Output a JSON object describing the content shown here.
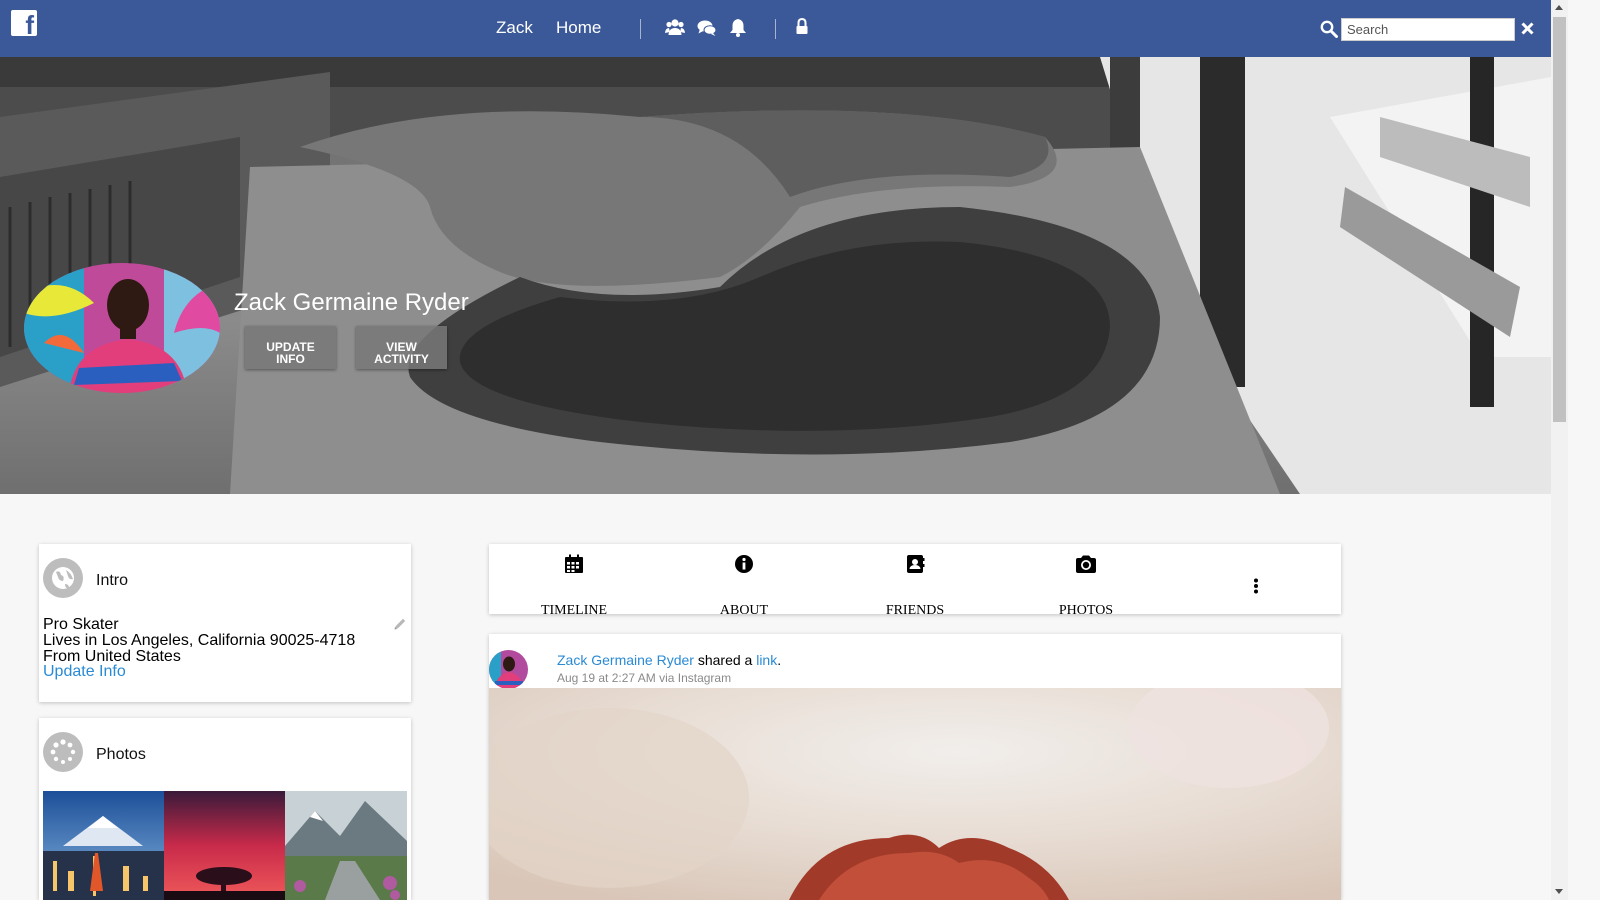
{
  "topbar": {
    "logo_letter": "f",
    "nav": [
      "Zack",
      "Home"
    ],
    "icons": [
      "users-icon",
      "chat-icon",
      "bell-icon",
      "lock-icon"
    ],
    "search_placeholder": "Search",
    "colors": {
      "bar": "#3b5998",
      "link": "#2a8ad4"
    }
  },
  "profile": {
    "name": "Zack Germaine Ryder",
    "buttons": [
      "UPDATE INFO",
      "VIEW ACTIVITY"
    ]
  },
  "intro": {
    "title": "Intro",
    "lines": [
      "Pro Skater",
      "Lives in Los Angeles, California 90025-4718",
      "From United States"
    ],
    "update_link": "Update Info"
  },
  "photos": {
    "title": "Photos"
  },
  "tabs": [
    "TIMELINE",
    "ABOUT",
    "FRIENDS",
    "PHOTOS"
  ],
  "post": {
    "author": "Zack Germaine Ryder",
    "action": "shared a",
    "object": "link",
    "period": ".",
    "meta": "Aug 19 at 2:27 AM via Instagram"
  }
}
